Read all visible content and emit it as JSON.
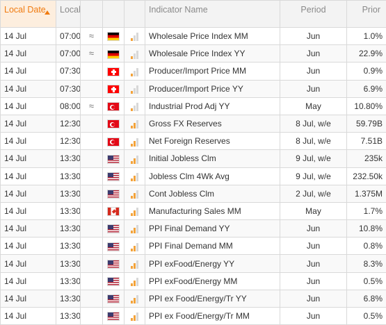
{
  "columns": {
    "date": "Local Date",
    "time": "Local Time",
    "indicator": "Indicator Name",
    "period": "Period",
    "prior": "Prior"
  },
  "colors": {
    "accent": "#f07b10",
    "impact_on": "#f3a33a",
    "impact_off": "#d8d8d8"
  },
  "rows": [
    {
      "date": "14 Jul",
      "time": "07:00",
      "vol": "≈",
      "country": "de",
      "impact": 1,
      "indicator": "Wholesale Price Index MM",
      "period": "Jun",
      "prior": "1.0%"
    },
    {
      "date": "14 Jul",
      "time": "07:00",
      "vol": "≈",
      "country": "de",
      "impact": 1,
      "indicator": "Wholesale Price Index YY",
      "period": "Jun",
      "prior": "22.9%"
    },
    {
      "date": "14 Jul",
      "time": "07:30",
      "vol": "",
      "country": "ch",
      "impact": 1,
      "indicator": "Producer/Import Price MM",
      "period": "Jun",
      "prior": "0.9%"
    },
    {
      "date": "14 Jul",
      "time": "07:30",
      "vol": "",
      "country": "ch",
      "impact": 1,
      "indicator": "Producer/Import Price YY",
      "period": "Jun",
      "prior": "6.9%"
    },
    {
      "date": "14 Jul",
      "time": "08:00",
      "vol": "≈",
      "country": "tr",
      "impact": 1,
      "indicator": "Industrial Prod Adj YY",
      "period": "May",
      "prior": "10.80%"
    },
    {
      "date": "14 Jul",
      "time": "12:30",
      "vol": "",
      "country": "tr",
      "impact": 2,
      "indicator": "Gross FX Reserves",
      "period": "8 Jul, w/e",
      "prior": "59.79B"
    },
    {
      "date": "14 Jul",
      "time": "12:30",
      "vol": "",
      "country": "tr",
      "impact": 2,
      "indicator": "Net Foreign Reserves",
      "period": "8 Jul, w/e",
      "prior": "7.51B"
    },
    {
      "date": "14 Jul",
      "time": "13:30",
      "vol": "",
      "country": "us",
      "impact": 2,
      "indicator": "Initial Jobless Clm",
      "period": "9 Jul, w/e",
      "prior": "235k"
    },
    {
      "date": "14 Jul",
      "time": "13:30",
      "vol": "",
      "country": "us",
      "impact": 2,
      "indicator": "Jobless Clm 4Wk Avg",
      "period": "9 Jul, w/e",
      "prior": "232.50k"
    },
    {
      "date": "14 Jul",
      "time": "13:30",
      "vol": "",
      "country": "us",
      "impact": 2,
      "indicator": "Cont Jobless Clm",
      "period": "2 Jul, w/e",
      "prior": "1.375M"
    },
    {
      "date": "14 Jul",
      "time": "13:30",
      "vol": "",
      "country": "ca",
      "impact": 2,
      "indicator": "Manufacturing Sales MM",
      "period": "May",
      "prior": "1.7%"
    },
    {
      "date": "14 Jul",
      "time": "13:30",
      "vol": "",
      "country": "us",
      "impact": 2,
      "indicator": "PPI Final Demand YY",
      "period": "Jun",
      "prior": "10.8%"
    },
    {
      "date": "14 Jul",
      "time": "13:30",
      "vol": "",
      "country": "us",
      "impact": 2,
      "indicator": "PPI Final Demand MM",
      "period": "Jun",
      "prior": "0.8%"
    },
    {
      "date": "14 Jul",
      "time": "13:30",
      "vol": "",
      "country": "us",
      "impact": 2,
      "indicator": "PPI exFood/Energy YY",
      "period": "Jun",
      "prior": "8.3%"
    },
    {
      "date": "14 Jul",
      "time": "13:30",
      "vol": "",
      "country": "us",
      "impact": 2,
      "indicator": "PPI exFood/Energy MM",
      "period": "Jun",
      "prior": "0.5%"
    },
    {
      "date": "14 Jul",
      "time": "13:30",
      "vol": "",
      "country": "us",
      "impact": 2,
      "indicator": "PPI ex Food/Energy/Tr YY",
      "period": "Jun",
      "prior": "6.8%"
    },
    {
      "date": "14 Jul",
      "time": "13:30",
      "vol": "",
      "country": "us",
      "impact": 2,
      "indicator": "PPI ex Food/Energy/Tr MM",
      "period": "Jun",
      "prior": "0.5%"
    }
  ]
}
